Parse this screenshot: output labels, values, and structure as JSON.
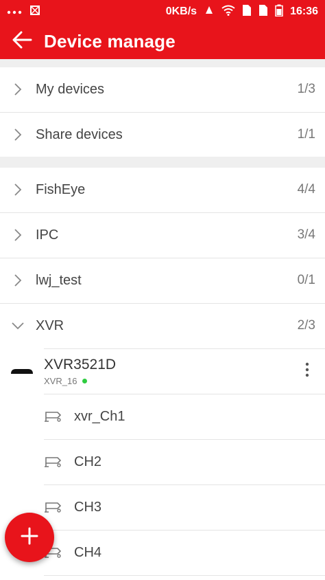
{
  "status_bar": {
    "left_icons": [
      "more-dots-icon",
      "bug-icon"
    ],
    "net_speed": "0KB/s",
    "right_icons": [
      "notification-icon",
      "wifi-icon",
      "sim-icon",
      "sim2-icon",
      "battery-icon"
    ],
    "time": "16:36"
  },
  "app_bar": {
    "title": "Device manage",
    "back_icon": "back-arrow-icon",
    "color": "#e8141b"
  },
  "sections": {
    "my_devices": {
      "label": "My devices",
      "count": "1/3"
    },
    "share_devices": {
      "label": "Share devices",
      "count": "1/1"
    }
  },
  "groups": [
    {
      "label": "FishEye",
      "count": "4/4",
      "expanded": false
    },
    {
      "label": "IPC",
      "count": "3/4",
      "expanded": false
    },
    {
      "label": "lwj_test",
      "count": "0/1",
      "expanded": false
    },
    {
      "label": "XVR",
      "count": "2/3",
      "expanded": true
    }
  ],
  "device": {
    "name": "XVR3521D",
    "sub": "XVR_16",
    "online_color": "#2ecc40",
    "menu_icon": "more-vert-icon"
  },
  "channels": [
    {
      "label": "xvr_Ch1"
    },
    {
      "label": "CH2"
    },
    {
      "label": "CH3"
    },
    {
      "label": "CH4"
    }
  ],
  "fab": {
    "icon": "plus-icon"
  }
}
